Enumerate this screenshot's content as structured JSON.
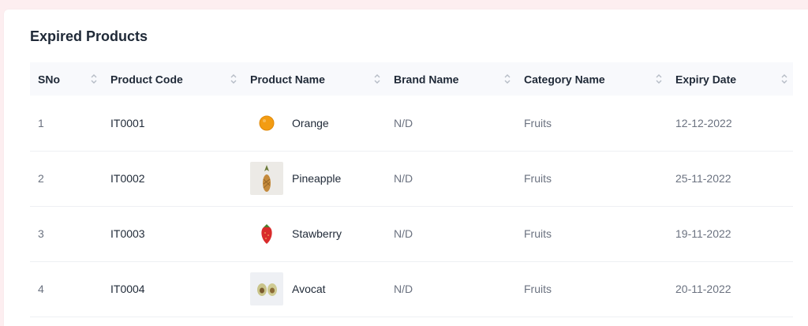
{
  "card": {
    "title": "Expired Products"
  },
  "table": {
    "columns": [
      {
        "key": "sno",
        "label": "SNo"
      },
      {
        "key": "code",
        "label": "Product Code"
      },
      {
        "key": "name",
        "label": "Product Name"
      },
      {
        "key": "brand",
        "label": "Brand Name"
      },
      {
        "key": "category",
        "label": "Category Name"
      },
      {
        "key": "expiry",
        "label": "Expiry Date"
      }
    ],
    "rows": [
      {
        "sno": "1",
        "code": "IT0001",
        "name": "Orange",
        "thumb": "orange-thumbnail",
        "brand": "N/D",
        "category": "Fruits",
        "expiry": "12-12-2022"
      },
      {
        "sno": "2",
        "code": "IT0002",
        "name": "Pineapple",
        "thumb": "pineapple-thumbnail",
        "brand": "N/D",
        "category": "Fruits",
        "expiry": "25-11-2022"
      },
      {
        "sno": "3",
        "code": "IT0003",
        "name": "Stawberry",
        "thumb": "strawberry-thumbnail",
        "brand": "N/D",
        "category": "Fruits",
        "expiry": "19-11-2022"
      },
      {
        "sno": "4",
        "code": "IT0004",
        "name": "Avocat",
        "thumb": "avocado-thumbnail",
        "brand": "N/D",
        "category": "Fruits",
        "expiry": "20-11-2022"
      }
    ]
  },
  "colors": {
    "page_bg": "#fdeef0",
    "header_bg": "#f8f9fc",
    "title_text": "#1f2937",
    "muted_text": "#6b7280"
  }
}
